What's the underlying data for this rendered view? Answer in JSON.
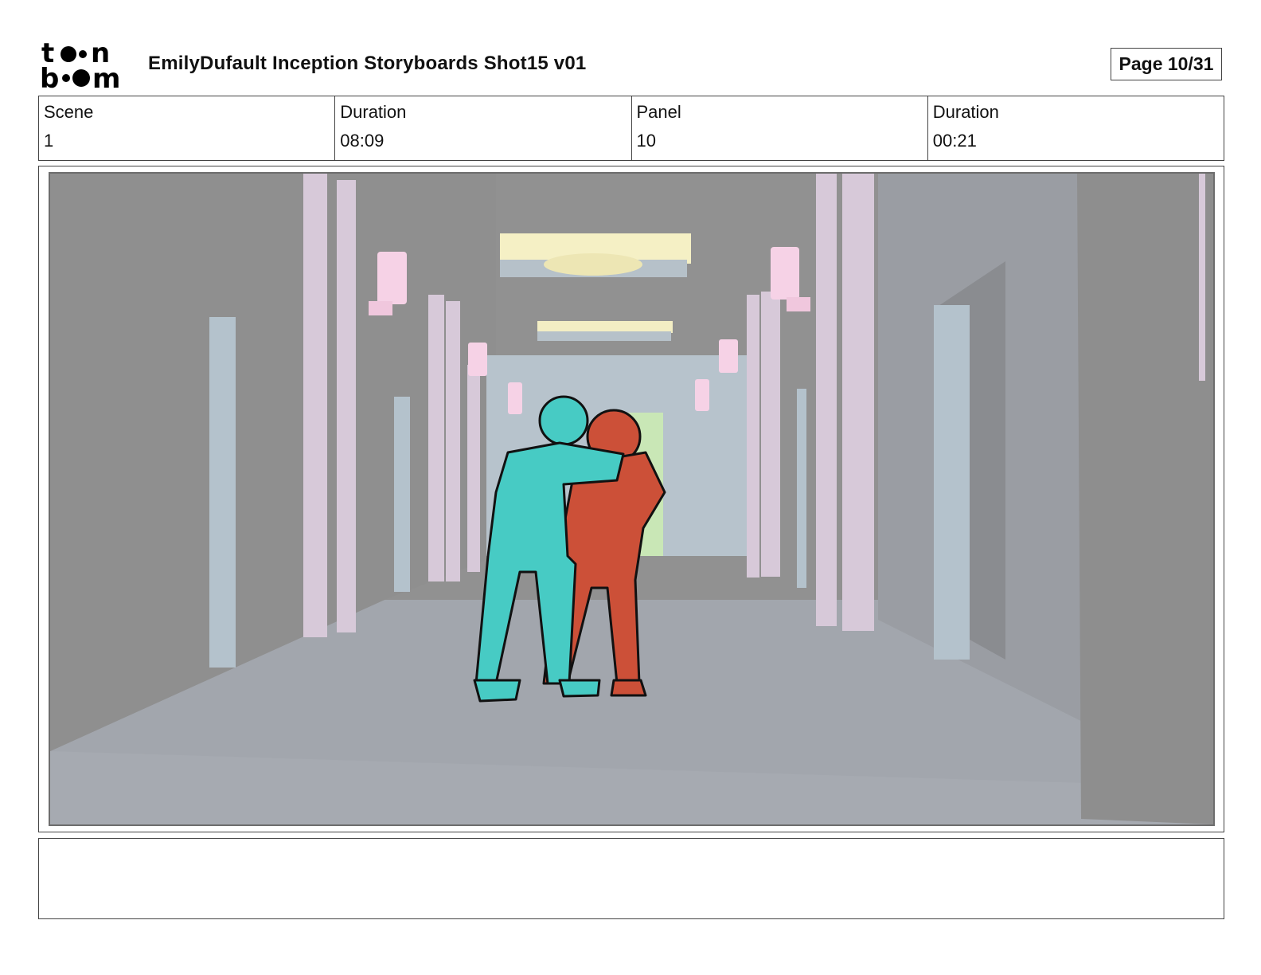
{
  "header": {
    "logo_text": "toon boom",
    "title": "EmilyDufault Inception Storyboards Shot15 v01",
    "page": "Page 10/31"
  },
  "info": [
    {
      "label": "Scene",
      "value": "1"
    },
    {
      "label": "Duration",
      "value": "08:09"
    },
    {
      "label": "Panel",
      "value": "10"
    },
    {
      "label": "Duration",
      "value": "00:21"
    }
  ],
  "notes": ""
}
